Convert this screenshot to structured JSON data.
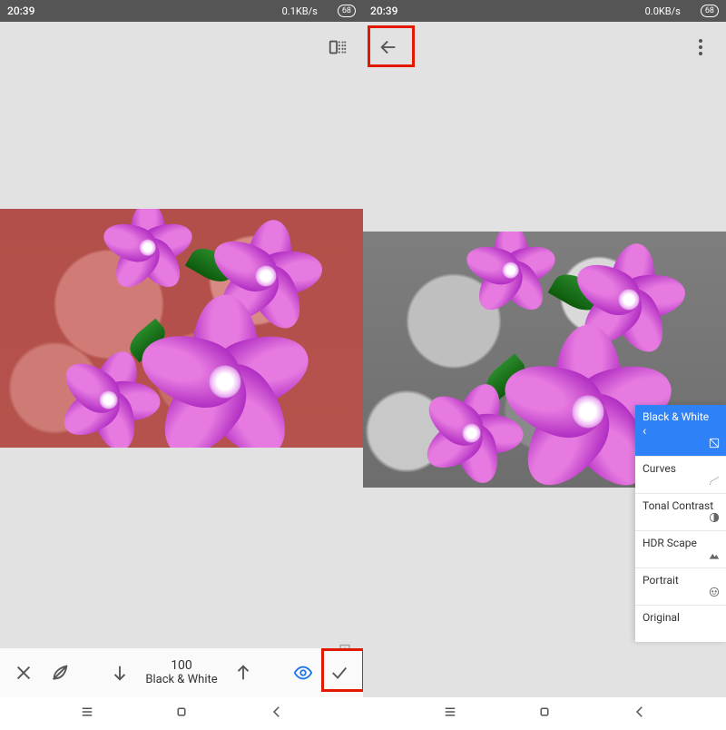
{
  "status": {
    "time": "20:39",
    "speed_left": "0.1KB/s",
    "speed_right": "0.0KB/s",
    "battery": "68"
  },
  "left": {
    "edit": {
      "value": "100",
      "label": "Black & White"
    }
  },
  "right": {
    "fx": {
      "selected": "Black & White",
      "items": [
        "Black & White",
        "Curves",
        "Tonal Contrast",
        "HDR Scape",
        "Portrait",
        "Original"
      ]
    }
  },
  "colors": {
    "accent": "#2e81f7",
    "highlight": "#E11900"
  }
}
